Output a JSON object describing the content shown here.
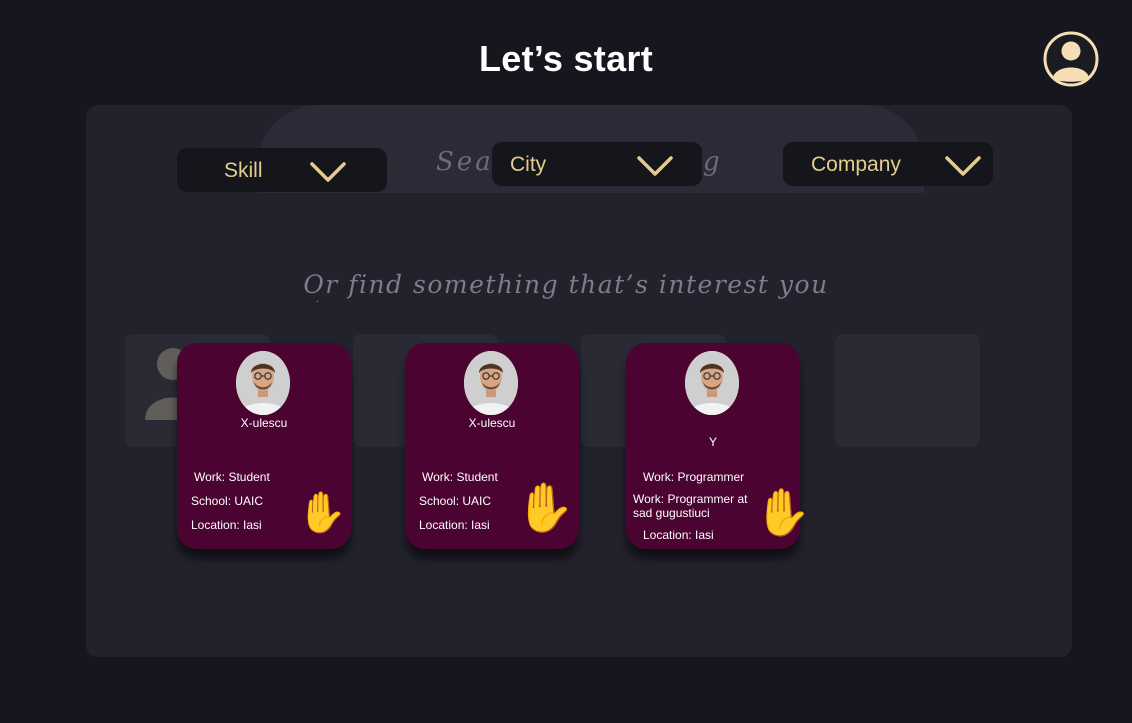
{
  "header": {
    "title": "Let’s start",
    "profile_icon": "user-avatar-icon",
    "accent_color": "#f5deb3"
  },
  "search": {
    "placeholder_text": "Search something"
  },
  "filters": {
    "skill_label": "Skill",
    "city_label": "City",
    "company_label": "Company",
    "chevron_color": "#e5cc8f"
  },
  "discover": {
    "prompt": "Or find something that’s interest you",
    "dot": "."
  },
  "cards": [
    {
      "name": "X-ulescu",
      "line1": "Work: Student",
      "line2": "School: UAIC",
      "line3": "Location: Iasi",
      "action_icon": "✋"
    },
    {
      "name": "X-ulescu",
      "line1": "Work: Student",
      "line2": "School: UAIC",
      "line3": "Location: Iasi",
      "action_icon": "✋"
    },
    {
      "name": "Y",
      "line1": "Work: Programmer",
      "line2": "Work: Programmer at sad gugustiuci",
      "line3": "Location: Iasi",
      "action_icon": "✋"
    }
  ],
  "colors": {
    "background": "#16161f",
    "panel": "#22222d",
    "card": "#4b0331",
    "dropdown_text": "#e5cc8f"
  }
}
